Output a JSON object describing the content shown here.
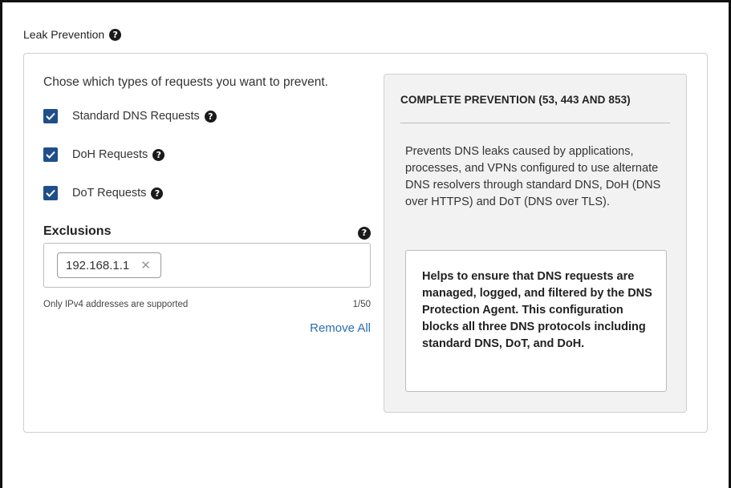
{
  "section": {
    "title": "Leak Prevention"
  },
  "options": {
    "prompt": "Chose which types of requests you want to prevent.",
    "items": [
      {
        "label": "Standard DNS Requests",
        "checked": true
      },
      {
        "label": "DoH Requests",
        "checked": true
      },
      {
        "label": "DoT Requests",
        "checked": true
      }
    ]
  },
  "exclusions": {
    "label": "Exclusions",
    "chips": [
      "192.168.1.1"
    ],
    "hint": "Only IPv4 addresses are supported",
    "counter": "1/50",
    "remove_all": "Remove All"
  },
  "info": {
    "title": "COMPLETE PREVENTION (53, 443 AND 853)",
    "description": "Prevents DNS leaks caused by applications, processes, and VPNs configured to use alternate DNS resolvers through standard DNS, DoH (DNS over HTTPS) and DoT (DNS over TLS).",
    "highlight": "Helps to ensure that DNS requests are managed, logged, and filtered by the DNS Protection Agent. This configuration blocks all three DNS protocols including standard DNS, DoT, and DoH."
  },
  "colors": {
    "checkbox": "#1f4f8a",
    "link": "#2b6cb0",
    "panel_bg": "#f2f2f2"
  },
  "icons": {
    "help": "help-circle-icon",
    "check": "checkmark-icon",
    "remove_chip": "close-icon"
  }
}
